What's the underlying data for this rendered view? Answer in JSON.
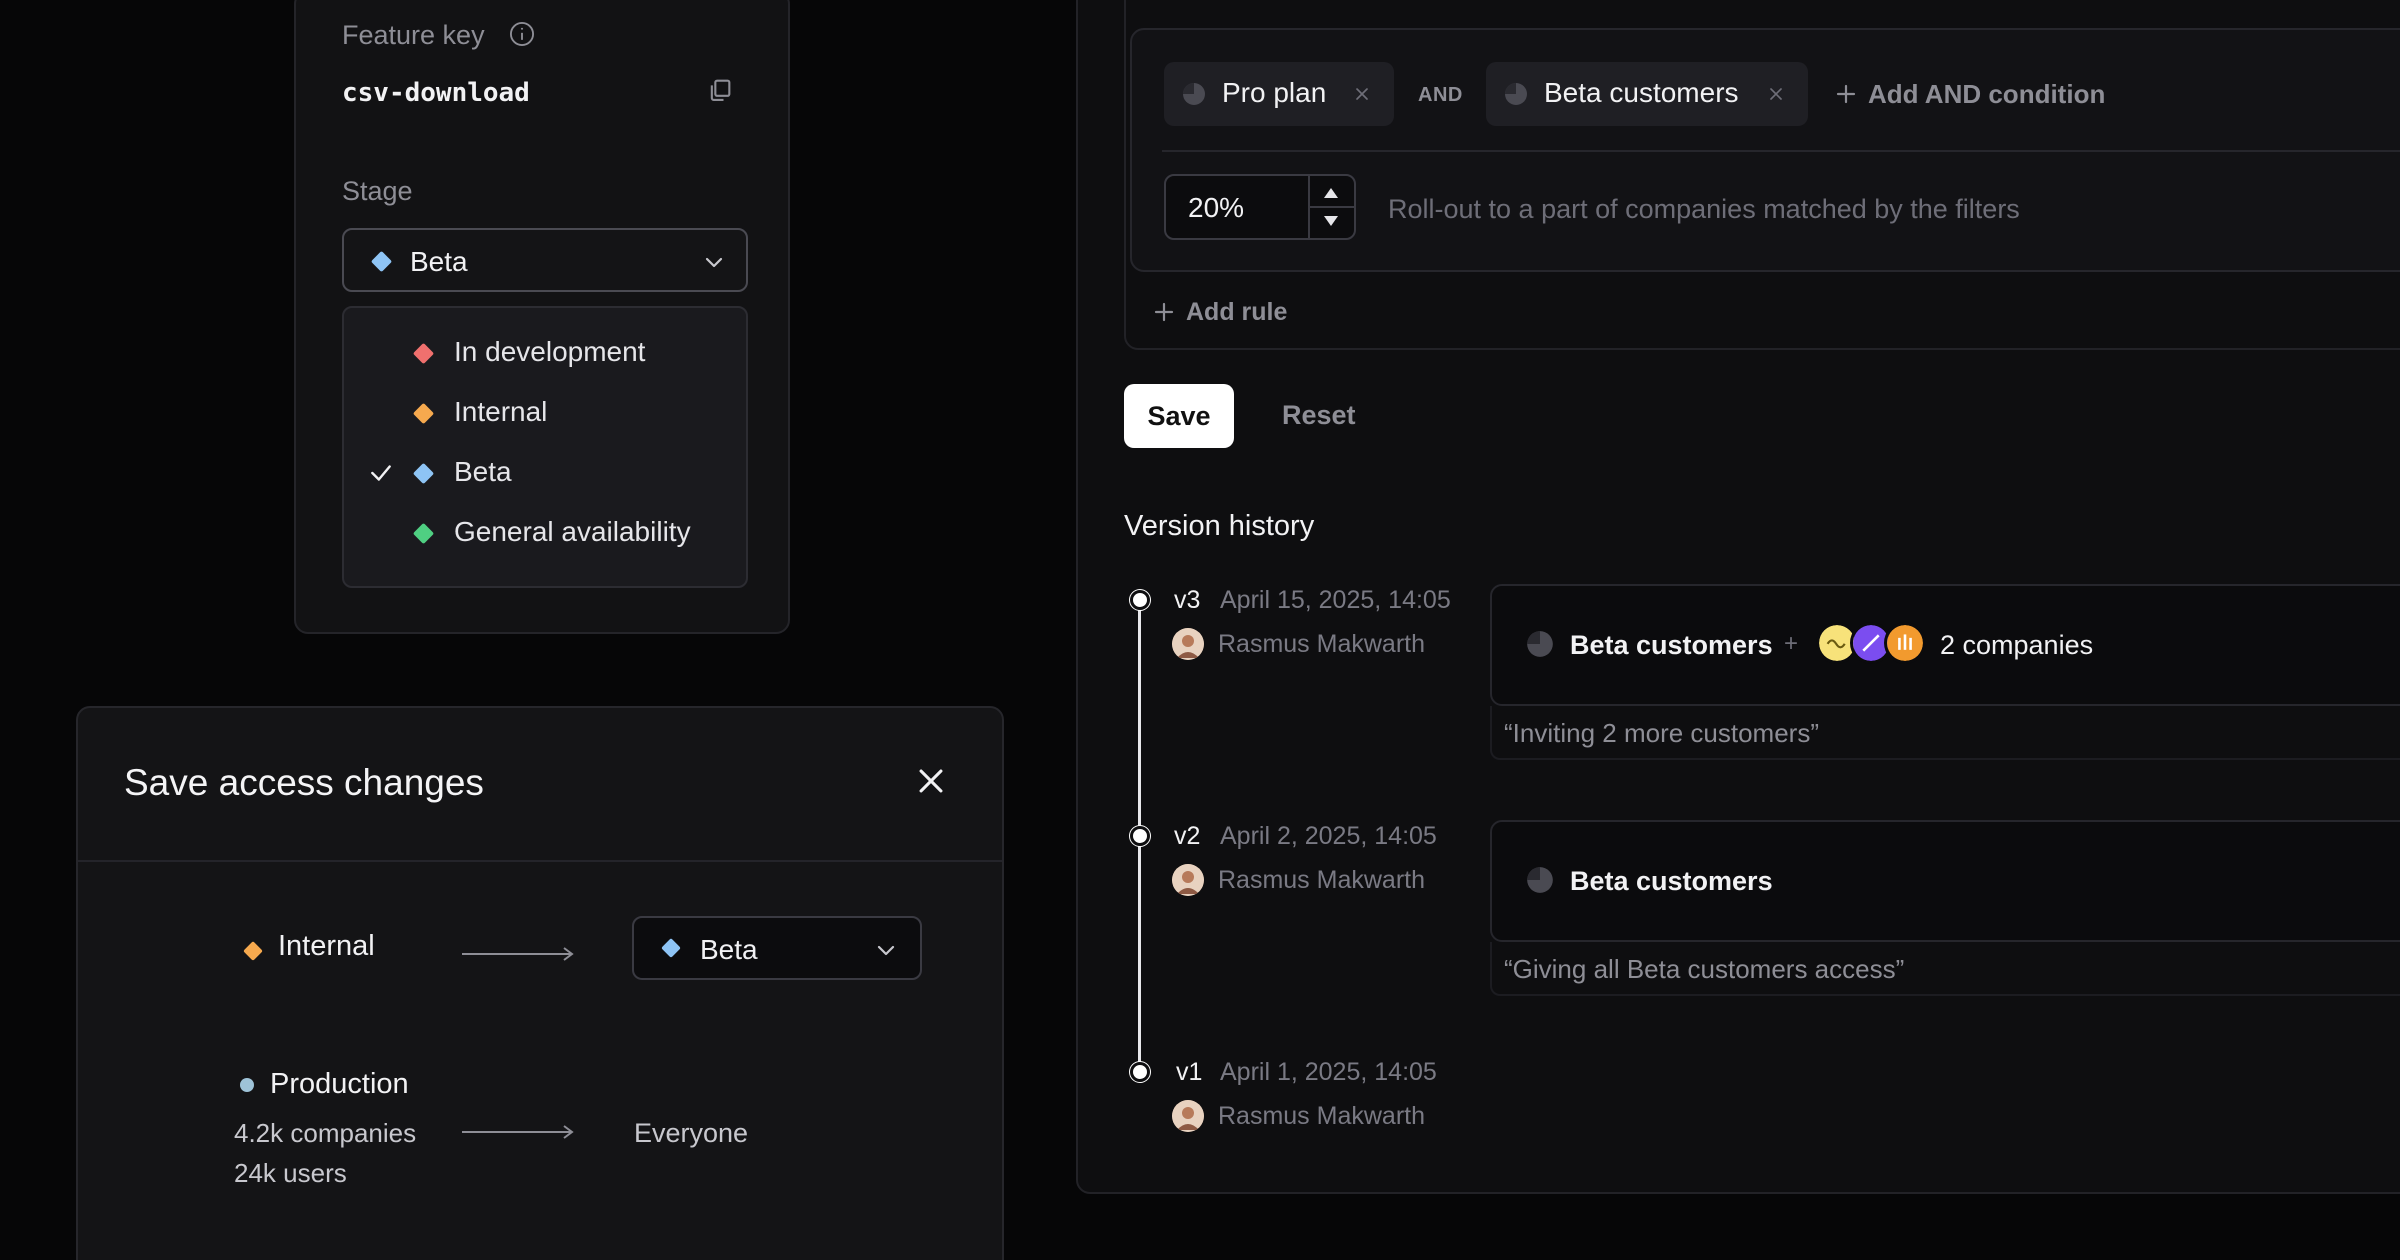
{
  "feature": {
    "key_label": "Feature key",
    "key_value": "csv-download",
    "stage_label": "Stage",
    "stage_selected": "Beta",
    "stage_options": [
      {
        "label": "In development",
        "color": "#F0706E",
        "selected": false
      },
      {
        "label": "Internal",
        "color": "#F6A94E",
        "selected": false
      },
      {
        "label": "Beta",
        "color": "#8EC4F5",
        "selected": true
      },
      {
        "label": "General availability",
        "color": "#4FCF82",
        "selected": false
      }
    ]
  },
  "modal": {
    "title": "Save access changes",
    "from_stage": "Internal",
    "from_stage_color": "#F6A94E",
    "to_stage": "Beta",
    "to_stage_color": "#8EC4F5",
    "env_label": "Production",
    "env_color": "#9EC3D8",
    "env_companies": "4.2k companies",
    "env_users": "24k users",
    "env_target": "Everyone"
  },
  "rules": {
    "conditions": [
      "Pro plan",
      "Beta customers"
    ],
    "and_label": "AND",
    "add_and_label": "Add AND condition",
    "rollout_value": "20%",
    "rollout_hint": "Roll-out to a part of companies matched by the filters",
    "add_rule_label": "Add rule"
  },
  "actions": {
    "save_label": "Save",
    "reset_label": "Reset"
  },
  "history": {
    "title": "Version history",
    "versions": [
      {
        "version": "v3",
        "date": "April 15, 2025, 14:05",
        "author": "Rasmus Makwarth",
        "segment": "Beta customers",
        "companies_label": "2 companies",
        "note": "“Inviting 2 more customers”"
      },
      {
        "version": "v2",
        "date": "April 2, 2025, 14:05",
        "author": "Rasmus Makwarth",
        "segment": "Beta customers",
        "note": "“Giving all Beta customers access”"
      },
      {
        "version": "v1",
        "date": "April 1, 2025, 14:05",
        "author": "Rasmus Makwarth"
      }
    ]
  }
}
